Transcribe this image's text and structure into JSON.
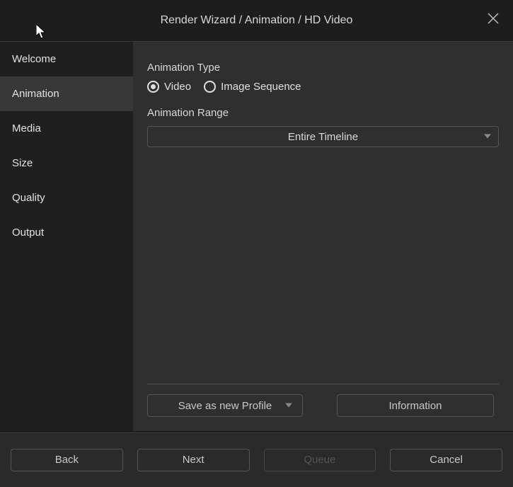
{
  "title": "Render Wizard / Animation / HD Video",
  "sidebar": {
    "items": [
      {
        "label": "Welcome"
      },
      {
        "label": "Animation"
      },
      {
        "label": "Media"
      },
      {
        "label": "Size"
      },
      {
        "label": "Quality"
      },
      {
        "label": "Output"
      }
    ],
    "active_index": 1
  },
  "content": {
    "animation_type_label": "Animation Type",
    "radio_options": [
      {
        "label": "Video",
        "selected": true
      },
      {
        "label": "Image Sequence",
        "selected": false
      }
    ],
    "animation_range_label": "Animation Range",
    "range_dropdown_value": "Entire Timeline",
    "save_profile_label": "Save as new Profile",
    "information_label": "Information"
  },
  "footer": {
    "back_label": "Back",
    "next_label": "Next",
    "queue_label": "Queue",
    "cancel_label": "Cancel"
  }
}
